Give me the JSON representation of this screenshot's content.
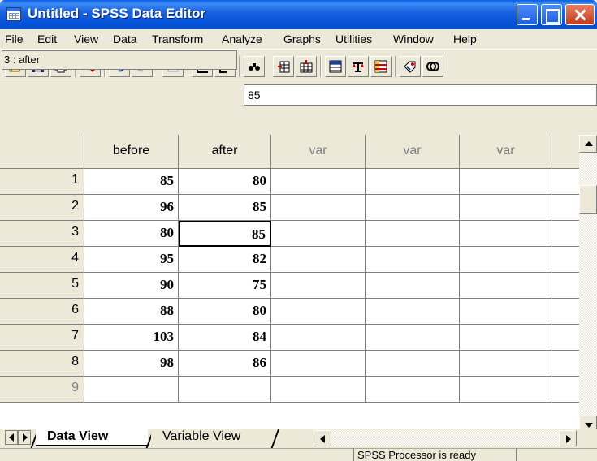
{
  "window": {
    "title": "Untitled - SPSS Data Editor"
  },
  "menubar": {
    "items": [
      "File",
      "Edit",
      "View",
      "Data",
      "Transform",
      "Analyze",
      "Graphs",
      "Utilities",
      "Window",
      "Help"
    ]
  },
  "toolbar": {
    "buttons": [
      "open-icon",
      "save-icon",
      "print-icon",
      "dialog-recall-icon",
      "undo-icon",
      "redo-icon",
      "goto-chart-icon",
      "goto-case-icon",
      "variables-icon",
      "find-icon",
      "insert-case-icon",
      "insert-variable-icon",
      "split-file-icon",
      "weight-cases-icon",
      "select-cases-icon",
      "value-labels-icon",
      "use-sets-icon"
    ]
  },
  "cell_editor": {
    "reference": "3 : after",
    "value": "85"
  },
  "grid": {
    "columns": [
      "before",
      "after",
      "var",
      "var",
      "var"
    ],
    "rows": [
      {
        "index": "1",
        "before": "85",
        "after": "80"
      },
      {
        "index": "2",
        "before": "96",
        "after": "85"
      },
      {
        "index": "3",
        "before": "80",
        "after": "85"
      },
      {
        "index": "4",
        "before": "95",
        "after": "82"
      },
      {
        "index": "5",
        "before": "90",
        "after": "75"
      },
      {
        "index": "6",
        "before": "88",
        "after": "80"
      },
      {
        "index": "7",
        "before": "103",
        "after": "84"
      },
      {
        "index": "8",
        "before": "98",
        "after": "86"
      },
      {
        "index": "9",
        "before": "",
        "after": ""
      }
    ],
    "active_cell": {
      "row": 3,
      "column": "after"
    }
  },
  "tabs": {
    "data_view": "Data View",
    "variable_view": "Variable View"
  },
  "status": {
    "message": "SPSS Processor  is ready"
  },
  "colors": {
    "title_blue": "#0a5ce8",
    "chrome": "#ece9d8"
  }
}
